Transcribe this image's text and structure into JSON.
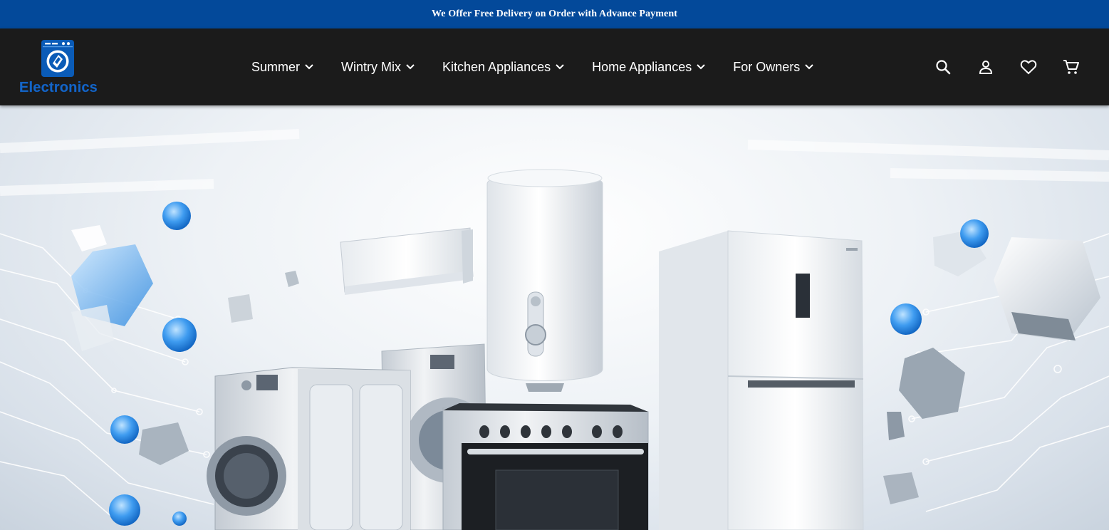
{
  "announcement": {
    "text": "We Offer Free Delivery on Order with Advance Payment"
  },
  "brand": {
    "name": "Electronics",
    "logo_icon": "washing-machine-logo-icon"
  },
  "nav": {
    "items": [
      {
        "label": "Summer",
        "icon": "chevron-down-icon"
      },
      {
        "label": "Wintry Mix",
        "icon": "chevron-down-icon"
      },
      {
        "label": "Kitchen Appliances",
        "icon": "chevron-down-icon"
      },
      {
        "label": "Home Appliances",
        "icon": "chevron-down-icon"
      },
      {
        "label": "For Owners",
        "icon": "chevron-down-icon"
      }
    ]
  },
  "header_icons": [
    "search-icon",
    "account-icon",
    "wishlist-heart-icon",
    "cart-icon"
  ],
  "hero": {
    "image": "hero-appliances-banner",
    "depicts": [
      "air-conditioner",
      "water-heater",
      "refrigerator",
      "washing-machine",
      "gas-cooker"
    ]
  },
  "colors": {
    "announcement_bg": "#03499a",
    "header_bg": "#1b1b1b",
    "brand_blue": "#1566c7",
    "text_white": "#ffffff"
  }
}
